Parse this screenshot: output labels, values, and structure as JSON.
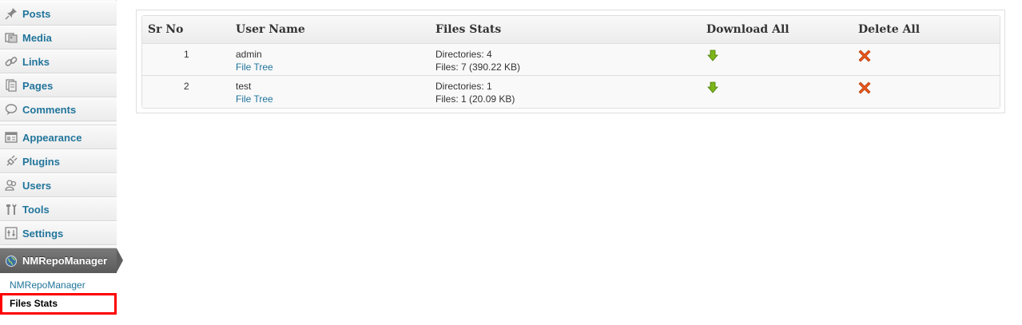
{
  "sidebar": {
    "items": [
      {
        "label": "Posts",
        "icon": "pin-icon"
      },
      {
        "label": "Media",
        "icon": "media-icon"
      },
      {
        "label": "Links",
        "icon": "link-icon"
      },
      {
        "label": "Pages",
        "icon": "pages-icon"
      },
      {
        "label": "Comments",
        "icon": "comment-icon"
      },
      {
        "label": "Appearance",
        "icon": "appearance-icon"
      },
      {
        "label": "Plugins",
        "icon": "plugin-icon"
      },
      {
        "label": "Users",
        "icon": "users-icon"
      },
      {
        "label": "Tools",
        "icon": "tools-icon"
      },
      {
        "label": "Settings",
        "icon": "settings-icon"
      }
    ],
    "active_menu": {
      "label": "NMRepoManager",
      "icon": "globe-icon"
    },
    "submenu": [
      {
        "label": "NMRepoManager"
      },
      {
        "label": "Files Stats"
      }
    ]
  },
  "table": {
    "headers": [
      "Sr No",
      "User Name",
      "Files Stats",
      "Download All",
      "Delete All"
    ],
    "rows": [
      {
        "sr": "1",
        "user": "admin",
        "link": "File Tree",
        "dirs": "Directories: 4",
        "files": "Files: 7 (390.22 KB)"
      },
      {
        "sr": "2",
        "user": "test",
        "link": "File Tree",
        "dirs": "Directories: 1",
        "files": "Files: 1 (20.09 KB)"
      }
    ]
  },
  "colors": {
    "link": "#21759b",
    "download": "#7cb518",
    "delete": "#e8561b",
    "highlight": "#ff0000"
  }
}
